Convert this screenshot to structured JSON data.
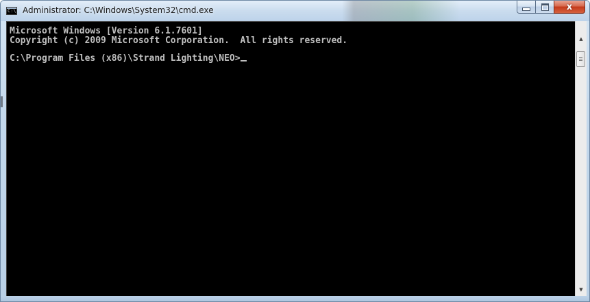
{
  "window": {
    "title": "Administrator: C:\\Windows\\System32\\cmd.exe",
    "icon": "cmd-icon",
    "icon_text": "C:\\.",
    "caption_buttons": {
      "minimize_icon": "minimize-icon",
      "maximize_icon": "maximize-icon",
      "close_icon": "close-icon",
      "close_glyph": "x"
    }
  },
  "console": {
    "lines": [
      "Microsoft Windows [Version 6.1.7601]",
      "Copyright (c) 2009 Microsoft Corporation.  All rights reserved.",
      "C:\\Program Files (x86)\\Strand Lighting\\NEO>"
    ],
    "background_color": "#000000",
    "text_color": "#c0c0c0"
  },
  "scrollbar": {
    "up_glyph": "▲",
    "down_glyph": "▼"
  },
  "colors": {
    "close_button": "#c4391a",
    "frame": "#c3d8ec"
  }
}
